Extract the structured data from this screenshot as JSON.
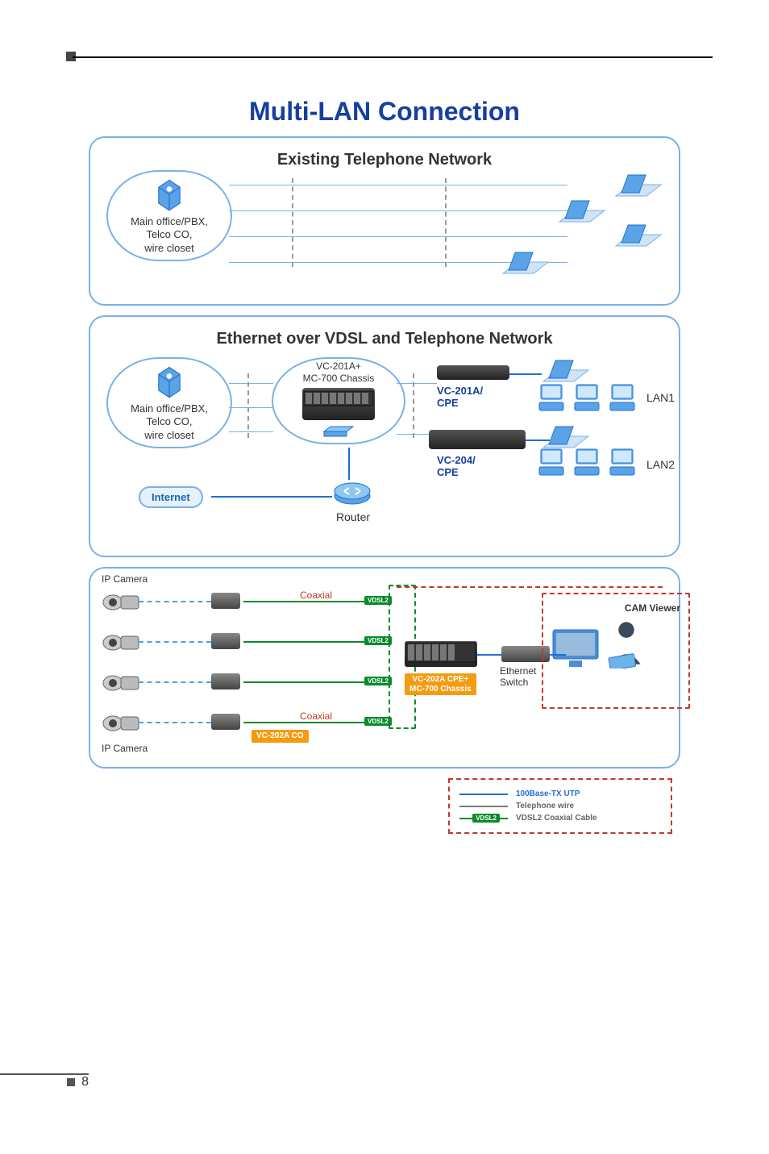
{
  "page": {
    "title": "Multi-LAN Connection",
    "number": "8"
  },
  "panel1": {
    "title": "Existing Telephone Network",
    "main_node": "Main office/PBX,\nTelco CO,\nwire closet"
  },
  "panel2": {
    "title": "Ethernet over VDSL and Telephone Network",
    "main_node": "Main office/PBX,\nTelco CO,\nwire closet",
    "center_device": "VC-201A+\nMC-700 Chassis",
    "cpe1": "VC-201A/\nCPE",
    "cpe2": "VC-204/\nCPE",
    "lan1": "LAN1",
    "lan2": "LAN2",
    "router": "Router",
    "internet": "Internet"
  },
  "panel3": {
    "ipcam_top": "IP Camera",
    "ipcam_bot": "IP Camera",
    "coax": "Coaxial",
    "vdsl2": "VDSL2",
    "vc202a_co": "VC-202A CO",
    "vc202a_cpe": "VC-202A CPE+\nMC-700 Chassis",
    "eth_switch": "Ethernet\nSwitch",
    "cam_viewer": "CAM Viewer"
  },
  "legend": {
    "utp": "100Base-TX UTP",
    "tel": "Telephone wire",
    "vdsl": "VDSL2 Coaxial Cable",
    "vdsl2_badge": "VDSL2"
  }
}
